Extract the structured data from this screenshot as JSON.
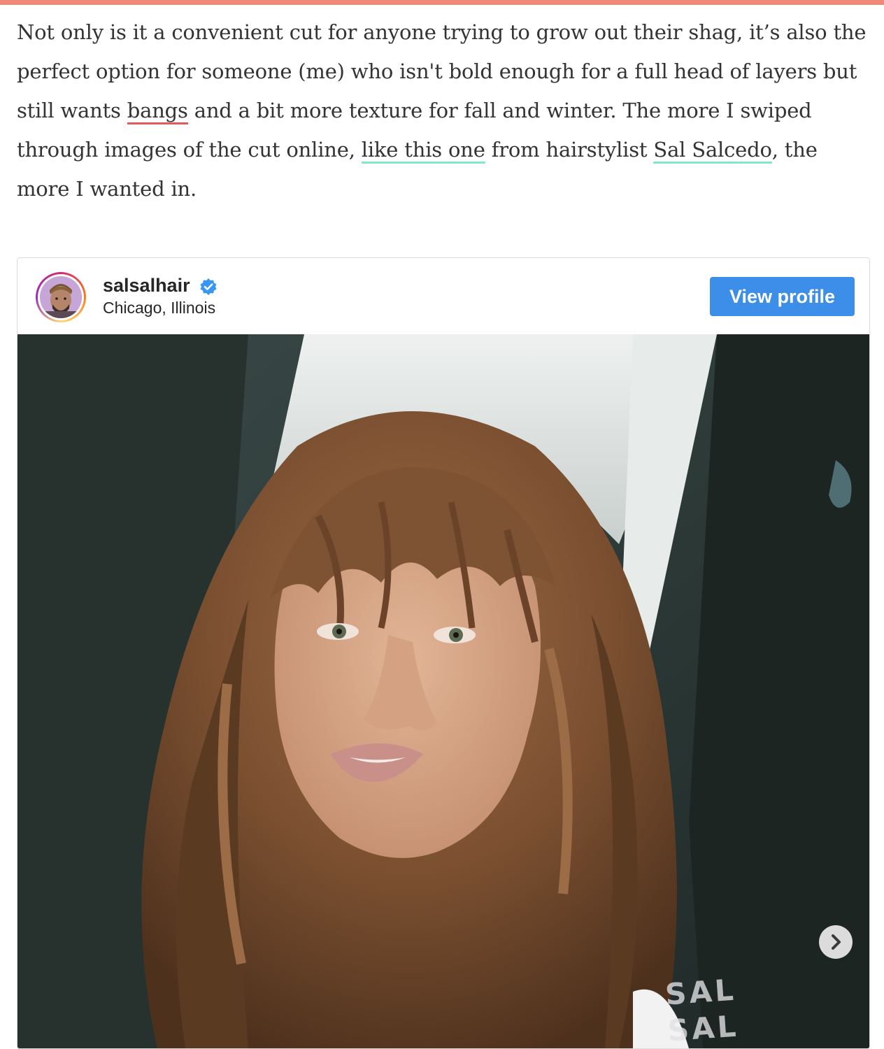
{
  "article": {
    "segments": [
      "Not only is it a convenient cut for anyone trying to grow out their shag, it’s also the perfect option for someone (me) who isn't bold enough for a full head of layers but still wants ",
      "bangs",
      " and a bit more texture for fall and winter. The more I swiped through images of the cut online, ",
      "like this one",
      " from hairstylist ",
      "Sal Salcedo",
      ", the more I wanted in."
    ]
  },
  "embed": {
    "username": "salsalhair",
    "location": "Chicago, Illinois",
    "view_profile_label": "View profile",
    "watermark_line1": "SAL",
    "watermark_line2": "SAL"
  },
  "colors": {
    "top_bar": "#ef8878",
    "link_underline_red": "#e05b5b",
    "link_underline_green": "#86e8c3",
    "button_blue": "#3d8ee8",
    "verified_blue": "#3897f0"
  },
  "icons": {
    "verified": "verified-badge-icon",
    "next": "chevron-right-icon"
  }
}
